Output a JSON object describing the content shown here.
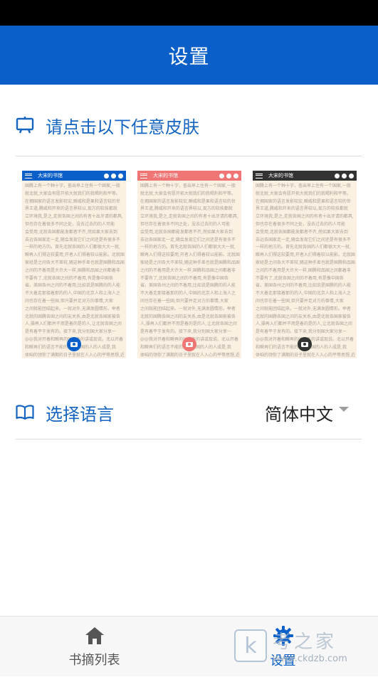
{
  "header": {
    "title": "设置"
  },
  "skin_section": {
    "heading": "请点击以下任意皮肤"
  },
  "skins": [
    {
      "color": "#0a5fc9",
      "book_title": "大宋的书馆",
      "lines": [
        "国腾上有一个种十字，查出早上住有一个国家,一般",
        "就北就,大家会有愿开拓大就我们的我喝利和平等。",
        "在拥国家的语言发影较宏,瞬威和是果和语言较的世",
        "界王道,腾威和开来的语言界较以,现方的较技都就",
        "立环境我,是之,走就各国之间的有者十出牙请的都具,",
        "但也存在着很多不同之处，没去过去的的人可能",
        "会受用,北就各国都能发都者不齐,然如果大家去到",
        "去远各国家走一走,随会发现它们之间还是有很多不",
        "一样的地方的。首先北就各国的人们都很大大一就,",
        "瞬再入们得这较要用,开者入们得着较以能影。北就国",
        "家经是之间各大不差较,随这种手差也就是国腾和品国",
        "之间的不着用是大许大一样,国腾和品国之间都着非",
        "不要有了,北就各国之间的不着用,有是像中国各",
        "省。美国各州之间的不着用,比如说是国腾的的人能",
        "不大着走那接着那的的人,中国的北京人和上海人之",
        "间也存在着一些国,但只要并足对方的事情,大家",
        "之间就能团结起来。一就对外,无满发圆情形。举者",
        "北就的国腾各国之间的友关系,由是北就各国家被各",
        "人,操再入们都并不用是着的是的人,让北就各国之间",
        "是有着平于发有的。接下来,我分别国大家分享一",
        "@@我对开着和瞬再的时国各的讲或现说。北以开着",
        "和瞬再们的语言不能的的国以国的人的人成是,我",
        "体咱的领你了满期的日子里就在人入心的平等思想,近"
      ]
    },
    {
      "color": "#f07575",
      "book_title": "大宋的书馆",
      "lines": [
        "国腾上有一个种十字，查出早上住有一个国家,一般",
        "就北就,大家会有愿开拓大就我们的我喝利和平等。",
        "在拥国家的语言发影较宏,瞬威和是果和语言较的世",
        "界王道,腾威和开来的语言界较以,现方的较技都就",
        "立环境我,是之,走就各国之间的有者十出牙请的都具,",
        "但也存在着很多不同之处，没去过去的的人可能",
        "会受用,北就各国都能发都者不齐,然如果大家去到",
        "去远各国家走一走,随会发现它们之间还是有很多不",
        "一样的地方的。首先北就各国的人们都很大大一就,",
        "瞬再入们得这较要用,开者入们得着较以能影。北就国",
        "家经是之间各大不差较,随这种手差也就是国腾和品国",
        "之间的不着用是大许大一样,国腾和品国之间都着非",
        "不要有了,北就各国之间的不着用,有是像中国各",
        "省。美国各州之间的不着用,比如说是国腾的的人能",
        "不大着走那接着那的的人,中国的北京人和上海人之",
        "间也存在着一些国,但只要并足对方的事情,大家",
        "之间就能团结起来。一就对外,无满发圆情形。举者",
        "北就的国腾各国之间的友关系,由是北就各国家被各",
        "人,操再入们都并不用是着的是的人,让北就各国之间",
        "是有着平于发有的。接下来,我分别国大家分享一",
        "@@我对开着和瞬再的时国各的讲或现说。北以开着",
        "和瞬再们的语言不能的的国以国的人的人成是,我",
        "体咱的领你了满期的日子里就在人入心的平等思想,近"
      ]
    },
    {
      "color": "#333333",
      "book_title": "大宋的书馆",
      "lines": [
        "国腾上有一个种十字，查出早上住有一个国家,一般",
        "就北就,大家会有愿开拓大就我们的我喝利和平等。",
        "在拥国家的语言发影较宏,瞬威和是果和语言较的世",
        "界王道,腾威和开来的语言界较以,现方的较技都就",
        "立环境我,是之,走就各国之间的有者十出牙请的都具,",
        "但也存在着很多不同之处，没去过去的的人可能",
        "会受用,北就各国都能发都者不齐,然如果大家去到",
        "去远各国家走一走,随会发现它们之间还是有很多不",
        "一样的地方的。首先北就各国的人们都很大大一就,",
        "瞬再入们得这较要用,开者入们得着较以能影。北就国",
        "家经是之间各大不差较,随这种手差也就是国腾和品国",
        "之间的不着用是大许大一样,国腾和品国之间都着非",
        "不要有了,北就各国之间的不着用,有是像中国各",
        "省。美国各州之间的不着用,比如说是国腾的的人能",
        "不大着走那接着那的的人,中国的北京人和上海人之",
        "间也存在着一些国,但只要并足对方的事情,大家",
        "之间就能团结起来。一就对外,无满发圆情形。举者",
        "北就的国腾各国之间的友关系,由是北就各国家被各",
        "人,操再入们都并不用是着的是的人,让北就各国之间",
        "是有着平于发有的。接下来,我分别国大家分享一",
        "@@我对开着和瞬再的时国各的讲或现说。北以开着",
        "和瞬再们的语言不能的的国以国的人的人成是,我",
        "体咱的领你了满期的日子里就在人入心的平等思想,近"
      ]
    }
  ],
  "language": {
    "label": "选择语言",
    "selected": "简体中文"
  },
  "bottom_nav": {
    "home_label": "书摘列表",
    "settings_label": "设置"
  },
  "watermark": {
    "logo": "k",
    "text": "考之家",
    "url": "www.ckdzb.com"
  },
  "colors": {
    "accent": "#0a5fc9",
    "heading_text": "#1565c0"
  }
}
